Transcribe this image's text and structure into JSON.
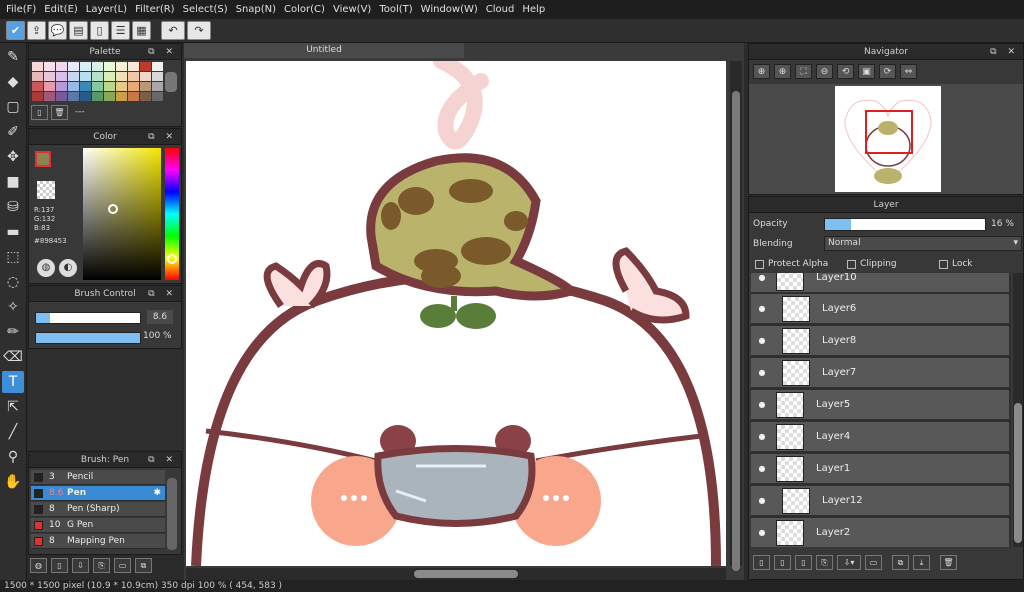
{
  "menu": [
    "File(F)",
    "Edit(E)",
    "Layer(L)",
    "Filter(R)",
    "Select(S)",
    "Snap(N)",
    "Color(C)",
    "View(V)",
    "Tool(T)",
    "Window(W)",
    "Cloud",
    "Help"
  ],
  "panels": {
    "palette_title": "Palette",
    "palette_hint": "---",
    "color_title": "Color",
    "color_r": "R:137",
    "color_g": "G:132",
    "color_b": "B:83",
    "color_hex": "#898453",
    "brush_control_title": "Brush Control",
    "brush_size": "8.6",
    "brush_opacity": "100 %",
    "brush_list_title": "Brush: Pen",
    "navigator_title": "Navigator",
    "layer_title": "Layer"
  },
  "document": {
    "tab_title": "Untitled"
  },
  "brushes": [
    {
      "size": "3",
      "name": "Pencil",
      "color": "#222222"
    },
    {
      "size": "8.6",
      "name": "Pen",
      "color": "#222222"
    },
    {
      "size": "8",
      "name": "Pen (Sharp)",
      "color": "#222222"
    },
    {
      "size": "10",
      "name": "G Pen",
      "color": "#e03030"
    },
    {
      "size": "8",
      "name": "Mapping Pen",
      "color": "#e03030"
    }
  ],
  "layer_panel": {
    "opacity_label": "Opacity",
    "opacity_value": "16 %",
    "opacity": 0.16,
    "blending_label": "Blending",
    "blending_value": "Normal",
    "protect_alpha": "Protect Alpha",
    "clipping": "Clipping",
    "lock": "Lock",
    "layers": [
      "Layer10",
      "Layer6",
      "Layer8",
      "Layer7",
      "Layer5",
      "Layer4",
      "Layer1",
      "Layer12",
      "Layer2"
    ]
  },
  "status": {
    "text": "1500 * 1500 pixel   (10.9 * 10.9cm)   350 dpi   100 %   ( 454, 583 )"
  },
  "colors": {
    "accent": "#3d8fd8",
    "main_color": "#898453",
    "outline": "#7a3b3f"
  }
}
